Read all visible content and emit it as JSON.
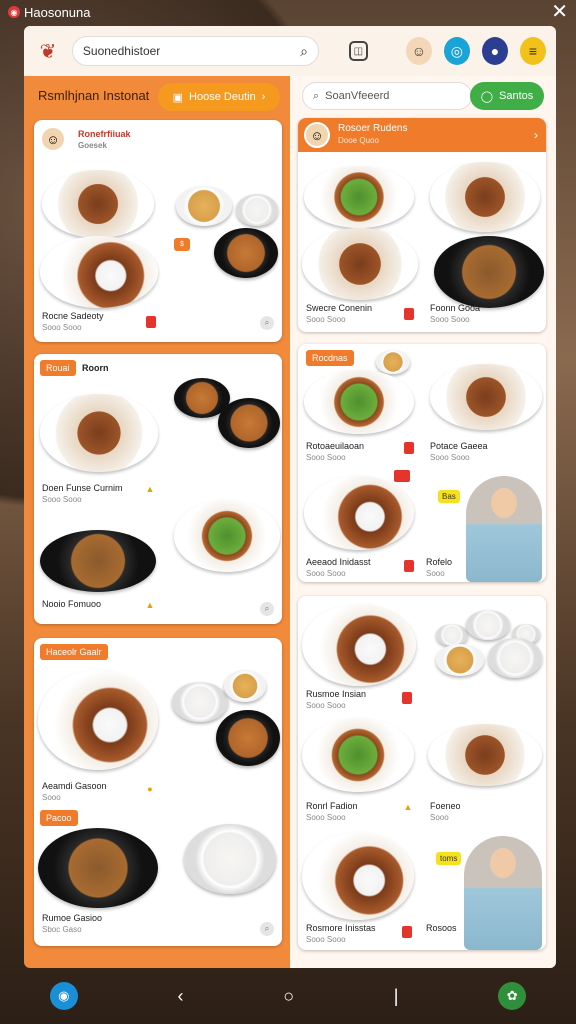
{
  "window": {
    "title": "Haosonuna",
    "close_icon": "close-icon"
  },
  "header": {
    "search_text": "Suonedhistoer",
    "search_icon": "search-icon"
  },
  "left_panel": {
    "title": "Rsmlhjnan Instonat",
    "order_button": "Hoose Deutin"
  },
  "right_panel": {
    "search_placeholder": "SoanVfeeerd",
    "go_button": "Santos"
  },
  "left_cards": [
    {
      "tag": "",
      "title": "Ronefrfiiuak",
      "subtitle": "Goesek",
      "cap1": "Rocne Sadeoty",
      "cap1_sub": ""
    },
    {
      "tag": "Rouai",
      "title": "Roorn",
      "cap1": "Doen Funse Curnim",
      "cap2": "Nooio Fomuoo"
    },
    {
      "tag": "Haceolr Gaalr",
      "cap1": "Aeamdi Gasoon",
      "tag2": "Pacoo",
      "cap2": "Rumoe Gasioo",
      "cap2_sub": "Sboc Gaso"
    }
  ],
  "right_cards": [
    {
      "title": "Rosoer Rudens",
      "subtitle": "Dooe Quoo",
      "cap1": "Swecre Conenin",
      "cap2": "Foonn Gooa"
    },
    {
      "tag": "Rocdnas",
      "cap1": "Rotoaeuilaoan",
      "cap2": "Potace Gaeea",
      "cap3": "Aeeaod Inidasst",
      "cap4": "Rofelo",
      "chip": "Bas"
    },
    {
      "cap1": "Rusmoe Insian",
      "cap2": "Ronrl Fadion",
      "cap3": "Foeneo",
      "cap4": "Rosmore Inisstas",
      "cap5": "Rosoos",
      "chip": "toms"
    }
  ],
  "navbar": {
    "home_icon": "back-icon",
    "center_icon": "home-circle-icon",
    "right_icon": "recents-icon"
  }
}
